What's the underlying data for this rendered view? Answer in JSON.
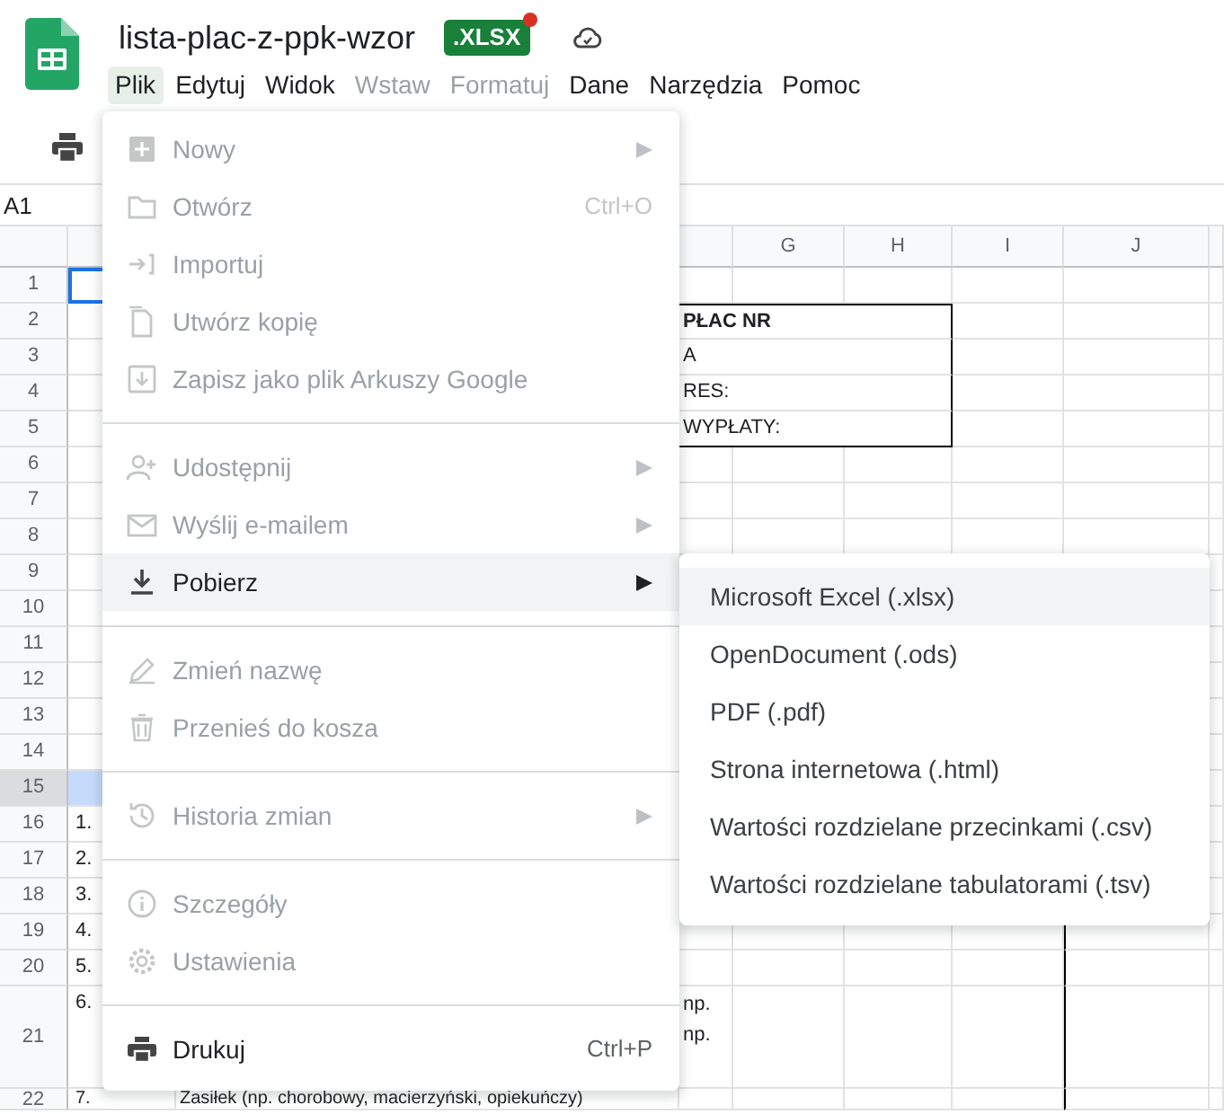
{
  "document": {
    "title": "lista-plac-z-ppk-wzor",
    "format_badge": ".XLSX",
    "badge_dot": true
  },
  "menubar": [
    {
      "label": "Plik",
      "selected": true,
      "disabled": false
    },
    {
      "label": "Edytuj",
      "selected": false,
      "disabled": false
    },
    {
      "label": "Widok",
      "selected": false,
      "disabled": false
    },
    {
      "label": "Wstaw",
      "selected": false,
      "disabled": true
    },
    {
      "label": "Formatuj",
      "selected": false,
      "disabled": true
    },
    {
      "label": "Dane",
      "selected": false,
      "disabled": false
    },
    {
      "label": "Narzędzia",
      "selected": false,
      "disabled": false
    },
    {
      "label": "Pomoc",
      "selected": false,
      "disabled": false
    }
  ],
  "name_box": "A1",
  "column_headers": [
    "G",
    "H",
    "I",
    "J"
  ],
  "rows": [
    {
      "number": "1",
      "active": true,
      "selected": false
    },
    {
      "number": "2",
      "active": false,
      "selected": false,
      "boxed": true,
      "bold": true,
      "overflow_lines": [
        "PŁAC NR"
      ]
    },
    {
      "number": "3",
      "active": false,
      "selected": false,
      "boxed": true,
      "overflow_lines": [
        "A"
      ]
    },
    {
      "number": "4",
      "active": false,
      "selected": false,
      "boxed": true,
      "overflow_lines": [
        "RES:"
      ]
    },
    {
      "number": "5",
      "active": false,
      "selected": false,
      "boxed": true,
      "overflow_lines": [
        "WYPŁATY:"
      ]
    },
    {
      "number": "6",
      "active": false,
      "selected": false
    },
    {
      "number": "7",
      "active": false,
      "selected": false
    },
    {
      "number": "8",
      "active": false,
      "selected": false
    },
    {
      "number": "9",
      "active": false,
      "selected": false
    },
    {
      "number": "10",
      "active": false,
      "selected": false
    },
    {
      "number": "11",
      "active": false,
      "selected": false
    },
    {
      "number": "12",
      "active": false,
      "selected": false
    },
    {
      "number": "13",
      "active": false,
      "selected": false
    },
    {
      "number": "14",
      "active": false,
      "selected": false
    },
    {
      "number": "15",
      "active": false,
      "selected": true
    },
    {
      "number": "16",
      "active": false,
      "selected": false,
      "column_a": "1."
    },
    {
      "number": "17",
      "active": false,
      "selected": false,
      "column_a": "2."
    },
    {
      "number": "18",
      "active": false,
      "selected": false,
      "column_a": "3."
    },
    {
      "number": "19",
      "active": false,
      "selected": false,
      "column_a": "4.",
      "ruled": true
    },
    {
      "number": "20",
      "active": false,
      "selected": false,
      "column_a": "5.",
      "ruled": true
    },
    {
      "number": "21",
      "active": false,
      "selected": false,
      "column_a": "6.",
      "ruled": true,
      "overflow_lines": [
        "np.",
        "np."
      ]
    },
    {
      "number": "22",
      "active": false,
      "selected": false,
      "column_a": "7.",
      "ruled": true,
      "column_b": "Zasiłek (np. chorobowy, macierzyński, opiekuńczy)"
    }
  ],
  "file_menu": [
    [
      {
        "label": "Nowy",
        "disabled": true,
        "submenu": true,
        "selected": false
      },
      {
        "label": "Otwórz",
        "disabled": true,
        "submenu": false,
        "shortcut": "Ctrl+O",
        "selected": false
      },
      {
        "label": "Importuj",
        "disabled": true,
        "submenu": false,
        "selected": false
      },
      {
        "label": "Utwórz kopię",
        "disabled": true,
        "submenu": false,
        "selected": false
      },
      {
        "label": "Zapisz jako plik Arkuszy Google",
        "disabled": true,
        "submenu": false,
        "selected": false
      }
    ],
    [
      {
        "label": "Udostępnij",
        "disabled": true,
        "submenu": true,
        "selected": false
      },
      {
        "label": "Wyślij e-mailem",
        "disabled": true,
        "submenu": true,
        "selected": false
      },
      {
        "label": "Pobierz",
        "disabled": false,
        "submenu": true,
        "selected": true
      }
    ],
    [
      {
        "label": "Zmień nazwę",
        "disabled": true,
        "submenu": false,
        "selected": false
      },
      {
        "label": "Przenieś do kosza",
        "disabled": true,
        "submenu": false,
        "selected": false
      }
    ],
    [
      {
        "label": "Historia zmian",
        "disabled": true,
        "submenu": true,
        "selected": false
      }
    ],
    [
      {
        "label": "Szczegóły",
        "disabled": true,
        "submenu": false,
        "selected": false
      },
      {
        "label": "Ustawienia",
        "disabled": true,
        "submenu": false,
        "selected": false
      }
    ],
    [
      {
        "label": "Drukuj",
        "disabled": false,
        "submenu": false,
        "shortcut": "Ctrl+P",
        "selected": false
      }
    ]
  ],
  "download_submenu": [
    {
      "label": "Microsoft Excel (.xlsx)",
      "selected": true
    },
    {
      "label": "OpenDocument (.ods)",
      "selected": false
    },
    {
      "label": "PDF (.pdf)",
      "selected": false
    },
    {
      "label": "Strona internetowa (.html)",
      "selected": false
    },
    {
      "label": "Wartości rozdzielane przecinkami (.csv)",
      "selected": false
    },
    {
      "label": "Wartości rozdzielane tabulatorami (.tsv)",
      "selected": false
    }
  ]
}
